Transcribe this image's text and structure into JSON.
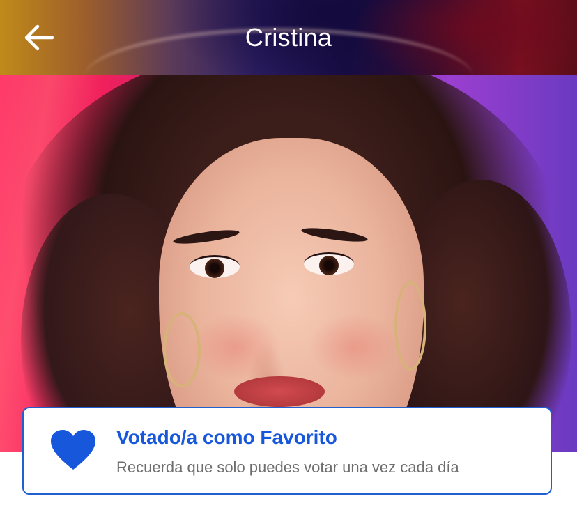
{
  "header": {
    "title": "Cristina",
    "back_icon": "arrow-left-icon"
  },
  "photo": {
    "subject": "profile-photo"
  },
  "vote_card": {
    "icon": "heart-icon",
    "icon_color": "#1757db",
    "title": "Votado/a como Favorito",
    "subtitle": "Recuerda que solo puedes votar una vez cada día",
    "border_color": "#1f5fd0"
  }
}
